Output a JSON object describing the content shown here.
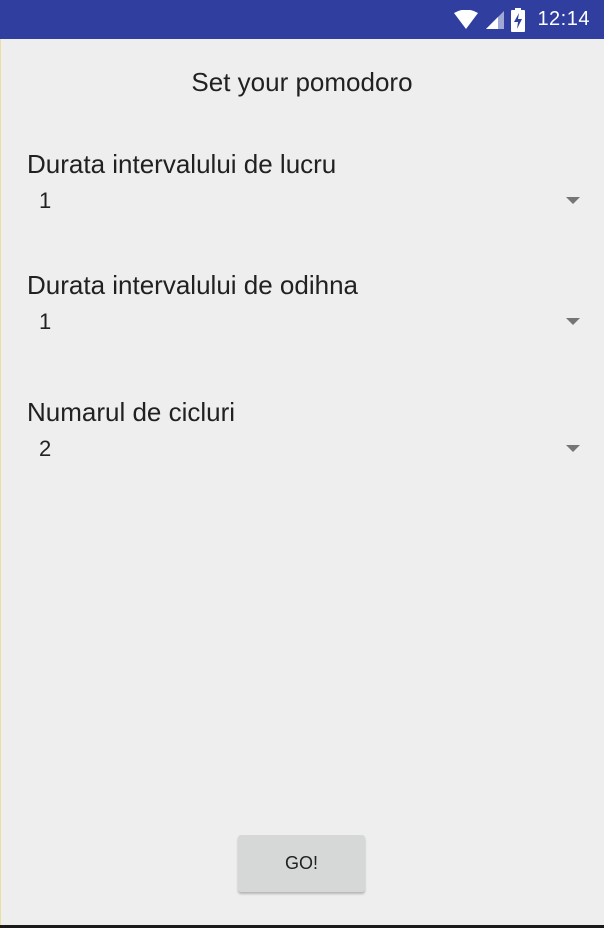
{
  "status_bar": {
    "time": "12:14",
    "background_color": "#303f9f",
    "icons": [
      "wifi-icon",
      "cellular-signal-icon",
      "battery-charging-icon"
    ]
  },
  "title": "Set your pomodoro",
  "fields": [
    {
      "label": "Durata intervalului de lucru",
      "value": "1"
    },
    {
      "label": "Durata intervalului de odihna",
      "value": "1"
    },
    {
      "label": "Numarul de cicluri",
      "value": "2"
    }
  ],
  "go_button": {
    "label": "GO!"
  },
  "colors": {
    "background": "#eeeeee",
    "button": "#d6d7d7",
    "text": "#212121",
    "spinner_arrow": "#757575"
  }
}
